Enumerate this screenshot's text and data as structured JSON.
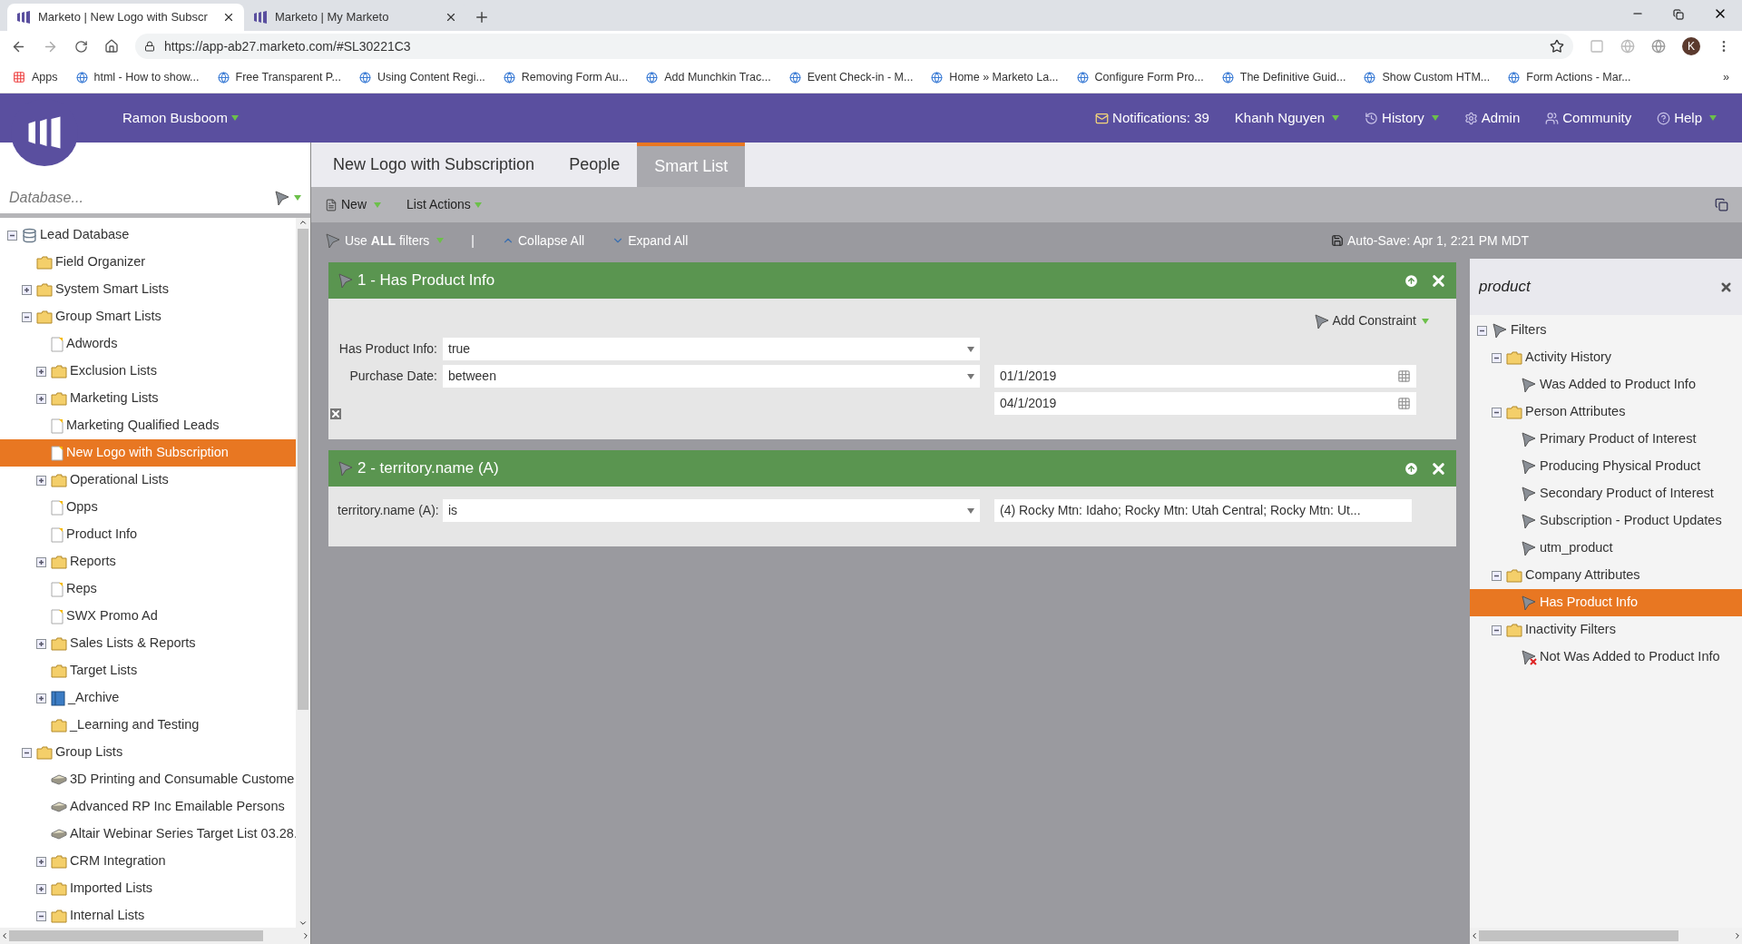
{
  "browser": {
    "tabs": [
      {
        "title": "Marketo | New Logo with Subscr",
        "selected": true
      },
      {
        "title": "Marketo | My Marketo",
        "selected": false
      }
    ],
    "address": "https://app-ab27.marketo.com/#SL30221C3",
    "profile_initial": "K",
    "bookmarks": [
      "Apps",
      "html - How to show...",
      "Free Transparent P...",
      "Using Content Regi...",
      "Removing Form Au...",
      "Add Munchkin Trac...",
      "Event Check-in - M...",
      "Home » Marketo La...",
      "Configure Form Pro...",
      "The Definitive Guid...",
      "Show Custom HTM...",
      "Form Actions - Mar..."
    ],
    "bookmarks_more": "»"
  },
  "header": {
    "workspace": "Ramon Busboom",
    "nav": [
      {
        "label": "Notifications: 39",
        "kind": "notifications",
        "caret": false
      },
      {
        "label": "Khanh Nguyen",
        "kind": "user",
        "caret": true
      },
      {
        "label": "History",
        "kind": "history",
        "caret": true
      },
      {
        "label": "Admin",
        "kind": "admin",
        "caret": false
      },
      {
        "label": "Community",
        "kind": "community",
        "caret": false
      },
      {
        "label": "Help",
        "kind": "help",
        "caret": true
      }
    ]
  },
  "sidebar": {
    "search_placeholder": "Database...",
    "tree": [
      {
        "label": "Lead Database",
        "kind": "database",
        "expanded": true,
        "selected": false,
        "children": [
          {
            "label": "Field Organizer",
            "kind": "folder",
            "selected": false
          },
          {
            "label": "System Smart Lists",
            "kind": "folder",
            "expanded": false,
            "selected": false
          },
          {
            "label": "Group Smart Lists",
            "kind": "folder",
            "expanded": true,
            "selected": false,
            "children": [
              {
                "label": "Adwords",
                "kind": "smart-list",
                "selected": false
              },
              {
                "label": "Exclusion Lists",
                "kind": "folder",
                "expanded": false,
                "selected": false
              },
              {
                "label": "Marketing Lists",
                "kind": "folder",
                "expanded": false,
                "selected": false
              },
              {
                "label": "Marketing Qualified Leads",
                "kind": "smart-list",
                "selected": false
              },
              {
                "label": "New Logo with Subscription",
                "kind": "smart-list",
                "selected": true
              },
              {
                "label": "Operational Lists",
                "kind": "folder",
                "expanded": false,
                "selected": false
              },
              {
                "label": "Opps",
                "kind": "smart-list",
                "selected": false
              },
              {
                "label": "Product Info",
                "kind": "smart-list",
                "selected": false
              },
              {
                "label": "Reports",
                "kind": "folder",
                "expanded": false,
                "selected": false
              },
              {
                "label": "Reps",
                "kind": "smart-list",
                "selected": false
              },
              {
                "label": "SWX Promo Ad",
                "kind": "smart-list",
                "selected": false
              },
              {
                "label": "Sales Lists & Reports",
                "kind": "folder",
                "expanded": false,
                "selected": false
              },
              {
                "label": "Target Lists",
                "kind": "folder",
                "selected": false
              },
              {
                "label": "_Archive",
                "kind": "archive",
                "expanded": false,
                "selected": false
              },
              {
                "label": "_Learning and Testing",
                "kind": "folder",
                "selected": false
              }
            ]
          },
          {
            "label": "Group Lists",
            "kind": "folder",
            "expanded": true,
            "selected": false,
            "children": [
              {
                "label": "3D Printing and Consumable Custome",
                "kind": "static-list",
                "selected": false
              },
              {
                "label": "Advanced RP Inc Emailable Persons",
                "kind": "static-list",
                "selected": false
              },
              {
                "label": "Altair Webinar Series Target List 03.28.",
                "kind": "static-list",
                "selected": false
              },
              {
                "label": "CRM Integration",
                "kind": "folder",
                "expanded": false,
                "selected": false
              },
              {
                "label": "Imported Lists",
                "kind": "folder",
                "expanded": false,
                "selected": false
              },
              {
                "label": "Internal Lists",
                "kind": "folder",
                "expanded": true,
                "selected": false
              }
            ]
          }
        ]
      }
    ]
  },
  "tabs": [
    {
      "label": "New Logo with Subscription",
      "selected": false
    },
    {
      "label": "People",
      "selected": false
    },
    {
      "label": "Smart List",
      "selected": true
    }
  ],
  "toolbar": {
    "new": "New",
    "list_actions": "List Actions"
  },
  "filter_bar": {
    "use_filters": "Use **ALL** filters",
    "separator": "|",
    "collapse": "Collapse All",
    "expand": "Expand All",
    "autosave": "Auto-Save: Apr 1, 2:21 PM MDT"
  },
  "filters": [
    {
      "title": "1 - Has Product Info",
      "add_constraint": "Add Constraint",
      "rows": [
        {
          "label": "Has Product Info:",
          "operator": "true",
          "kind": "plain"
        },
        {
          "label": "Purchase Date:",
          "operator": "between",
          "kind": "date",
          "values": [
            "01/1/2019",
            "04/1/2019"
          ]
        }
      ]
    },
    {
      "title": "2 - territory.name (A)",
      "rows": [
        {
          "label": "territory.name (A):",
          "operator": "is",
          "kind": "text",
          "values": [
            "(4) Rocky Mtn: Idaho; Rocky Mtn: Utah Central; Rocky Mtn: Ut..."
          ]
        }
      ]
    }
  ],
  "filter_panel": {
    "search": "product",
    "tree": [
      {
        "label": "Filters",
        "kind": "filter",
        "expanded": true,
        "selected": false,
        "children": [
          {
            "label": "Activity History",
            "kind": "folder",
            "expanded": true,
            "selected": false,
            "children": [
              {
                "label": "Was Added to Product Info",
                "kind": "filter",
                "selected": false
              }
            ]
          },
          {
            "label": "Person Attributes",
            "kind": "folder",
            "expanded": true,
            "selected": false,
            "children": [
              {
                "label": "Primary Product of Interest",
                "kind": "filter",
                "selected": false
              },
              {
                "label": "Producing Physical Product",
                "kind": "filter",
                "selected": false
              },
              {
                "label": "Secondary Product of Interest",
                "kind": "filter",
                "selected": false
              },
              {
                "label": "Subscription - Product Updates",
                "kind": "filter",
                "selected": false
              },
              {
                "label": "utm_product",
                "kind": "filter",
                "selected": false
              }
            ]
          },
          {
            "label": "Company Attributes",
            "kind": "folder",
            "expanded": true,
            "selected": false,
            "children": [
              {
                "label": "Has Product Info",
                "kind": "filter",
                "selected": true
              }
            ]
          },
          {
            "label": "Inactivity Filters",
            "kind": "folder",
            "expanded": true,
            "selected": false,
            "children": [
              {
                "label": "Not Was Added to Product Info",
                "kind": "negated-filter",
                "selected": false
              }
            ]
          }
        ]
      }
    ]
  }
}
